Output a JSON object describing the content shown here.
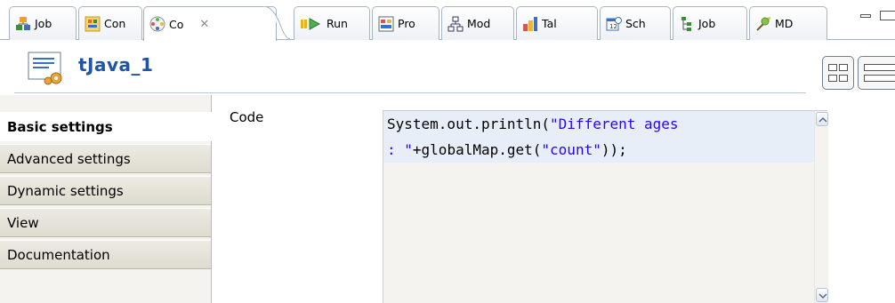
{
  "tabs": [
    {
      "label": "Job",
      "icon": "job-designs-icon"
    },
    {
      "label": "Con",
      "icon": "contexts-icon"
    },
    {
      "label": "Co",
      "icon": "component-icon",
      "active": true
    },
    {
      "label": "Run",
      "icon": "run-icon"
    },
    {
      "label": "Pro",
      "icon": "problems-icon"
    },
    {
      "label": "Mod",
      "icon": "modules-icon"
    },
    {
      "label": "Tal",
      "icon": "talend-exchange-icon"
    },
    {
      "label": "Sch",
      "icon": "scheduler-icon"
    },
    {
      "label": "Job",
      "icon": "job-hierarchy-icon"
    },
    {
      "label": "MD",
      "icon": "metadata-icon"
    }
  ],
  "component": {
    "title": "tJava_1",
    "icon": "tjava-component-icon"
  },
  "nav": {
    "items": [
      {
        "label": "Basic settings",
        "active": true
      },
      {
        "label": "Advanced settings"
      },
      {
        "label": "Dynamic settings"
      },
      {
        "label": "View"
      },
      {
        "label": "Documentation"
      }
    ]
  },
  "settings": {
    "code_label": "Code",
    "code_line_1_pre": "System.out.println(",
    "code_line_1_str": "\"Different ages",
    "code_line_2_str1": ": \"",
    "code_line_2_mid": "+globalMap.get(",
    "code_line_2_str2": "\"count\"",
    "code_line_2_post": "));"
  },
  "colors": {
    "title": "#1f55a6",
    "string": "#2a00ff",
    "code_bg": "#f4f3ef",
    "line_highlight": "#e8eef8"
  }
}
